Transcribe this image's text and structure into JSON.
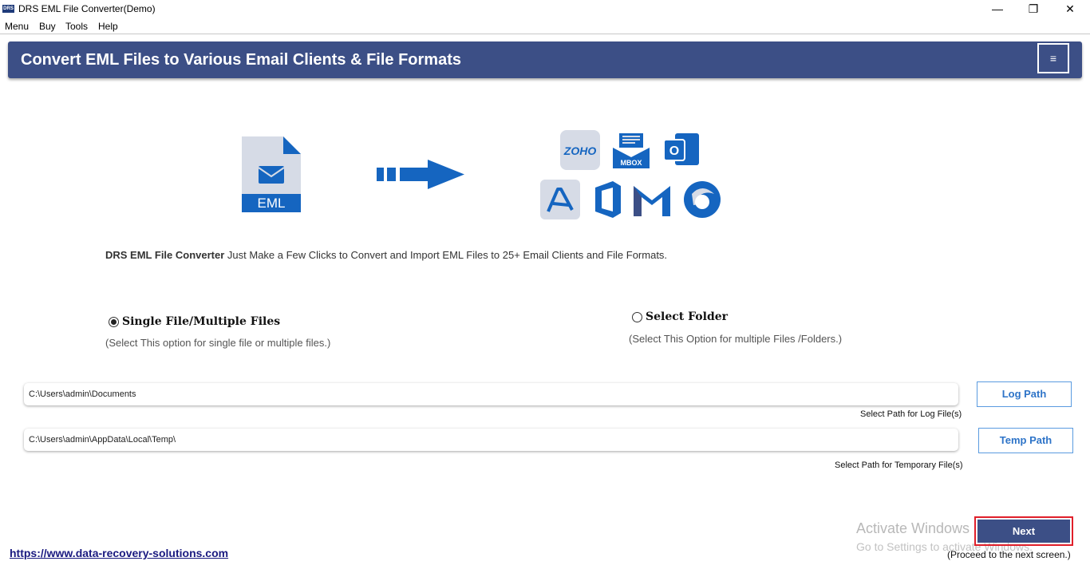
{
  "window": {
    "title": "DRS EML File Converter(Demo)",
    "logo_text": "DRS",
    "minimize": "—",
    "restore": "❐",
    "close": "✕"
  },
  "menu": [
    "Menu",
    "Buy",
    "Tools",
    "Help"
  ],
  "header": {
    "title": "Convert EML Files to Various Email Clients & File Formats",
    "menu_icon": "≡"
  },
  "illustration": {
    "source_label": "EML",
    "targets": [
      "zoho-icon",
      "mbox-icon",
      "outlook-icon",
      "pdf-icon",
      "office365-icon",
      "gmail-icon",
      "thunderbird-icon"
    ],
    "zoho_text": "ZOHO",
    "mbox_text": "MBOX",
    "outlook_text": "O"
  },
  "description": {
    "product": "DRS EML File Converter",
    "text": " Just Make a Few Clicks to Convert and Import EML Files to 25+ Email Clients and File Formats."
  },
  "options": {
    "single": {
      "label": "Single File/Multiple Files",
      "hint": "(Select This option for single file or multiple files.)",
      "checked": true
    },
    "folder": {
      "label": "Select Folder",
      "hint": "(Select This Option for multiple Files /Folders.)",
      "checked": false
    }
  },
  "log_path": {
    "value": "C:\\Users\\admin\\Documents",
    "caption": "Select Path for Log File(s)",
    "button": "Log Path"
  },
  "temp_path": {
    "value": "C:\\Users\\admin\\AppData\\Local\\Temp\\",
    "caption": "Select Path for Temporary File(s)",
    "button": "Temp Path"
  },
  "watermark": {
    "line1": "Activate Windows",
    "line2": "Go to Settings to activate Windows."
  },
  "next": {
    "label": "Next",
    "hint": "(Proceed to the next screen.)"
  },
  "footer": {
    "link": "https://www.data-recovery-solutions.com"
  },
  "colors": {
    "header_bg": "#3c4f86",
    "accent_blue": "#1565c0",
    "button_text": "#2e74c8",
    "next_border": "#e01f2a"
  }
}
